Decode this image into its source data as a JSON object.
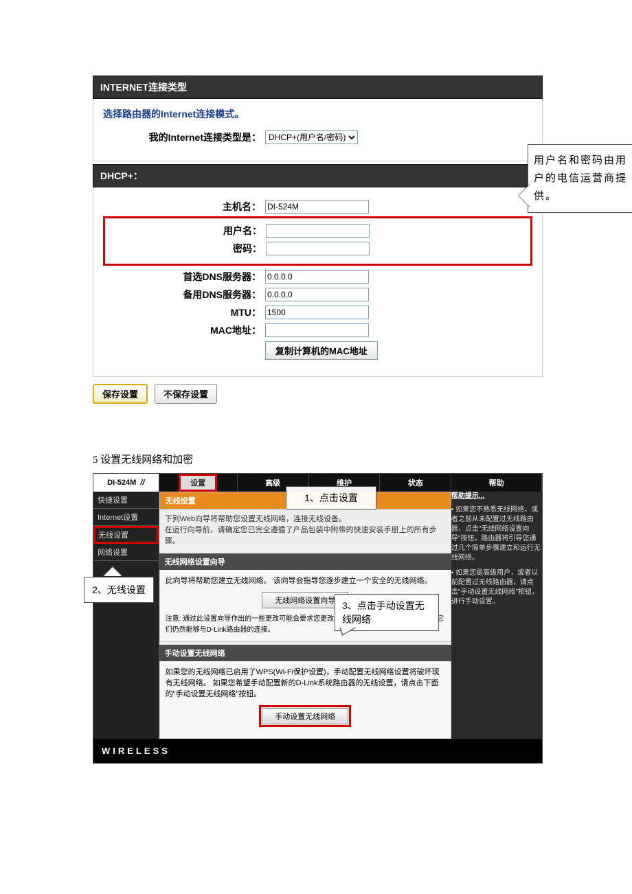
{
  "panel1": {
    "title": "INTERNET连接类型",
    "select_head": "选择路由器的Internet连接模式。",
    "my_type_label": "我的Internet连接类型是：",
    "my_type_value": "DHCP+(用户名/密码)",
    "section2_title": "DHCP+：",
    "hostname_label": "主机名：",
    "hostname_value": "DI-524M",
    "username_label": "用户名：",
    "username_value": "",
    "password_label": "密码：",
    "password_value": "",
    "dns1_label": "首选DNS服务器：",
    "dns1_value": "0.0.0.0",
    "dns2_label": "备用DNS服务器：",
    "dns2_value": "0.0.0.0",
    "mtu_label": "MTU：",
    "mtu_value": "1500",
    "mac_label": "MAC地址：",
    "mac_value": "",
    "copy_mac_btn": "复制计算机的MAC地址",
    "save_btn": "保存设置",
    "nosave_btn": "不保存设置",
    "callout_text": "用户名和密码由用户的电信运营商提供。"
  },
  "step_title": "5    设置无线网络和加密",
  "router": {
    "model": "DI-524M",
    "tabs": {
      "t1": "设置",
      "t2": "高级",
      "t3": "维护",
      "t4": "状态",
      "t5": "帮助"
    },
    "side": {
      "s1": "快捷设置",
      "s2": "Internet设置",
      "s3": "无线设置",
      "s4": "网络设置"
    },
    "orange_head": "无线设置",
    "intro_line1": "下列Web向导将帮助您设置无线网络，连接无线设备。",
    "intro_line2": "在运行向导前，请确定您已完全遵循了产品包装中附带的快速安装手册上的所有步骤。",
    "wiz_head": "无线网络设置向导",
    "wiz_body": "此向导将帮助您建立无线网络。 该向导会指导您逐步建立一个安全的无线网络。",
    "wiz_btn": "无线网络设置向导",
    "wiz_note": "注意: 通过此设置向导作出的一些更改可能会要求您更改无线客户端设备的一些设置，以便它们仍然能够与D-Link路由器的连接。",
    "man_head": "手动设置无线网络",
    "man_body": "如果您的无线网络已启用了WPS(Wi-Fi保护设置)，手动配置无线网络设置将破坏现有无线网络。  如果您希望手动配置新的D-Link系统路由器的无线设置，请点击下面的\"手动设置无线网络\"按钮。",
    "man_btn": "手动设置无线网络",
    "help_head": "帮助提示...",
    "help_p1": "• 如果您不熟悉无线网络，或者之前从未配置过无线路由器，点击\"无线网络设置向导\"按钮，路由器将引导您通过几个简单步骤建立和运行无线网络。",
    "help_p2": "• 如果您是高级用户，或者以前配置过无线路由器，请点击\"手动设置无线网络\"按钮，进行手动设置。",
    "footer": "WIRELESS",
    "bubble1": "1、点击设置",
    "bubble2": "2、无线设置",
    "bubble3": "3、点击手动设置无线网络"
  }
}
